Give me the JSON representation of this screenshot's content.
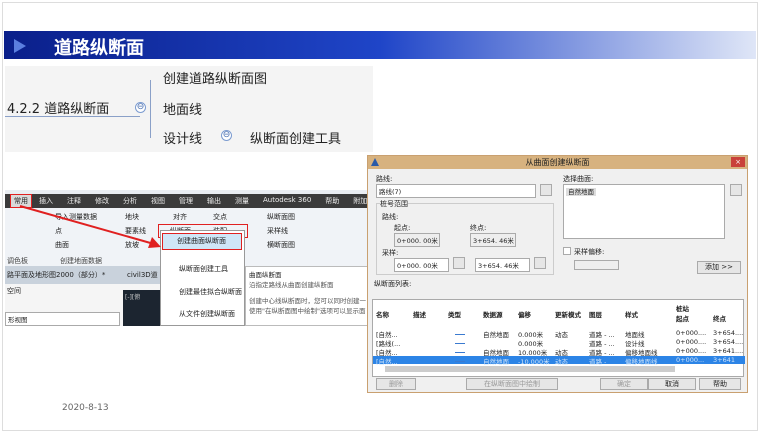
{
  "slide": {
    "title": "道路纵断面",
    "date": "2020-8-13"
  },
  "mindmap": {
    "root": "4.2.2 道路纵断面",
    "children": [
      "创建道路纵断面图",
      "地面线",
      "设计线"
    ],
    "grandchild": "纵断面创建工具",
    "collapse_symbol": "⊖"
  },
  "ribbon": {
    "menu": [
      "常用",
      "插入",
      "注释",
      "修改",
      "分析",
      "视图",
      "管理",
      "输出",
      "测量",
      "Autodesk 360",
      "帮助",
      "附加模块"
    ],
    "items": [
      "导入测量数据",
      "点",
      "曲面",
      "地块",
      "要素线",
      "放坡",
      "对齐",
      "纵断面",
      "交点",
      "装配",
      "纵断面图",
      "采样线",
      "横断面图"
    ],
    "groups": [
      "调色板",
      "创建地面数据"
    ],
    "doc_tab": "路平面及地形图2000（部分）*",
    "doc_tab2": "civil3D道",
    "panel_title": "空间",
    "panel_select": "形视图",
    "viewport_label": "[-][俯"
  },
  "dropdown": {
    "items": [
      "创建曲面纵断面",
      "纵断面创建工具",
      "创建最佳拟合纵断面",
      "从文件创建纵断面"
    ]
  },
  "tooltip": {
    "title": "曲面纵断面",
    "line1": "沿指定路线从曲面创建纵断面",
    "line2": "创建中心线纵断面时，您可以同时创建一",
    "line3": "使用\"在纵断面图中绘制\"选项可以显示面"
  },
  "dialog": {
    "title": "从曲面创建纵断面",
    "close": "×",
    "alignment_label": "路线:",
    "alignment_value": "路线(7)",
    "station_range": "桩号范围",
    "alignment_sub": "路线:",
    "start_label": "起点:",
    "end_label": "终点:",
    "start_value": "0+000. 00米",
    "end_value": "3+654. 46米",
    "sample_label": "采样:",
    "sample_start": "0+000. 00米",
    "sample_end": "3+654. 46米",
    "surface_label": "选择曲面:",
    "surface_item": "自然地面",
    "offset_label": "采样偏移:",
    "add_button": "添加 >>",
    "list_label": "纵断面列表:",
    "columns": [
      "名称",
      "描述",
      "类型",
      "数据源",
      "偏移",
      "更新模式",
      "图层",
      "样式",
      "桩站",
      "起点",
      "终点"
    ],
    "rows": [
      [
        "[自然...",
        "",
        "",
        "自然地面",
        "0.000米",
        "动态",
        "道路 - ...",
        "地面线",
        "0+000....",
        "3+654...."
      ],
      [
        "[路线(...",
        "",
        "",
        "",
        "0.000米",
        "",
        "道路 - ...",
        "设计线",
        "0+000....",
        "3+654...."
      ],
      [
        "[自然...",
        "",
        "",
        "自然地面",
        "10.000米",
        "动态",
        "道路 - ...",
        "偏移地面线",
        "0+000....",
        "3+641...."
      ],
      [
        "[自然...",
        "",
        "",
        "自然地面",
        "-10.000米",
        "动态",
        "道路 -",
        "偏移地面线",
        "0+000...",
        "3+641"
      ]
    ],
    "buttons": {
      "delete": "删除",
      "draw": "在纵断面图中绘制",
      "ok": "确定",
      "cancel": "取消",
      "help": "帮助"
    }
  },
  "colors": {
    "accent": "#1f45c8",
    "highlight": "#e02020",
    "selection": "#2c84e6"
  }
}
